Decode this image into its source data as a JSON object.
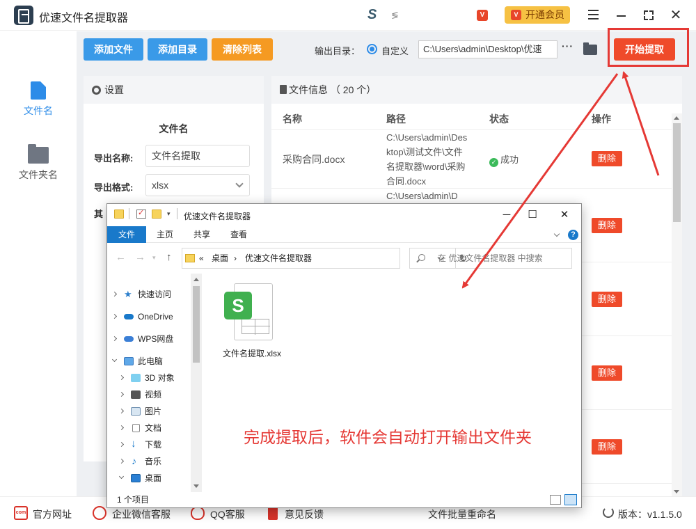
{
  "app": {
    "title": "优速文件名提取器",
    "brand_mark": "S",
    "brand_text": "≶",
    "vip_mini": "V",
    "vip_button": "开通会员",
    "vip_icon_text": "V"
  },
  "window_controls": {
    "close": "✕"
  },
  "nav": [
    {
      "label": "文件名",
      "active": true
    },
    {
      "label": "文件夹名",
      "active": false
    }
  ],
  "toolbar": {
    "add_file": "添加文件",
    "add_dir": "添加目录",
    "clear": "清除列表",
    "output_label": "输出目录：",
    "radio_label": "自定义",
    "output_path": "C:\\Users\\admin\\Desktop\\优速",
    "more": "···",
    "start": "开始提取"
  },
  "settings": {
    "header": "设置",
    "subtitle": "文件名",
    "export_name_label": "导出名称:",
    "export_name_value": "文件名提取",
    "export_format_label": "导出格式:",
    "export_format_value": "xlsx",
    "hidden_label_char": "其"
  },
  "file_info": {
    "header": "文件信息 （ 20 个）",
    "columns": {
      "name": "名称",
      "path": "路径",
      "status": "状态",
      "action": "操作"
    },
    "rows": [
      {
        "name": "采购合同.docx",
        "path": "C:\\Users\\admin\\Desktop\\测试文件\\文件名提取器\\word\\采购合同.docx",
        "status": "成功",
        "action": "删除"
      },
      {
        "name": "",
        "path": "C:\\Users\\admin\\D",
        "status": "",
        "action": "删除"
      },
      {
        "name": "",
        "path": "",
        "status": "",
        "action": "删除"
      },
      {
        "name": "",
        "path": "",
        "status": "",
        "action": "删除"
      },
      {
        "name": "",
        "path": "",
        "status": "",
        "action": "删除"
      }
    ]
  },
  "footer": {
    "website": "官方网址",
    "wechat": "企业微信客服",
    "qq": "QQ客服",
    "feedback": "意见反馈",
    "web_icon_text": "com",
    "rename": "文件批量重命名",
    "version_label": "版本：",
    "version": "v1.1.5.0"
  },
  "explorer": {
    "title": "优速文件名提取器",
    "tabs": [
      "文件",
      "主页",
      "共享",
      "查看"
    ],
    "help": "?",
    "breadcrumb": [
      "«",
      "桌面",
      "›",
      "优速文件名提取器"
    ],
    "search_placeholder": "在 优速文件名提取器 中搜索",
    "tree": [
      {
        "label": "快速访问",
        "level": 0,
        "open": false,
        "icon": "star-icon"
      },
      {
        "label": "OneDrive",
        "level": 0,
        "open": false,
        "icon": "cloud-icon"
      },
      {
        "label": "WPS网盘",
        "level": 0,
        "open": false,
        "icon": "cloud-icon"
      },
      {
        "label": "此电脑",
        "level": 0,
        "open": true,
        "icon": "computer-icon"
      },
      {
        "label": "3D 对象",
        "level": 1,
        "open": false,
        "icon": "cube-icon"
      },
      {
        "label": "视频",
        "level": 1,
        "open": false,
        "icon": "film-icon"
      },
      {
        "label": "图片",
        "level": 1,
        "open": false,
        "icon": "picture-icon"
      },
      {
        "label": "文档",
        "level": 1,
        "open": false,
        "icon": "document-icon"
      },
      {
        "label": "下载",
        "level": 1,
        "open": false,
        "icon": "download-icon"
      },
      {
        "label": "音乐",
        "level": 1,
        "open": false,
        "icon": "music-icon"
      },
      {
        "label": "桌面",
        "level": 1,
        "open": true,
        "icon": "desktop-icon"
      }
    ],
    "file": {
      "name": "文件名提取.xlsx",
      "badge": "S"
    },
    "notice": "完成提取后，软件会自动打开输出文件夹",
    "status": "1 个项目"
  },
  "colors": {
    "accent_blue": "#3a9ae8",
    "clear_orange": "#f59a22",
    "start_red": "#ef4a2a",
    "annotation_red": "#e53935",
    "vip_yellow": "#f6c143",
    "success_green": "#3bba5a"
  }
}
